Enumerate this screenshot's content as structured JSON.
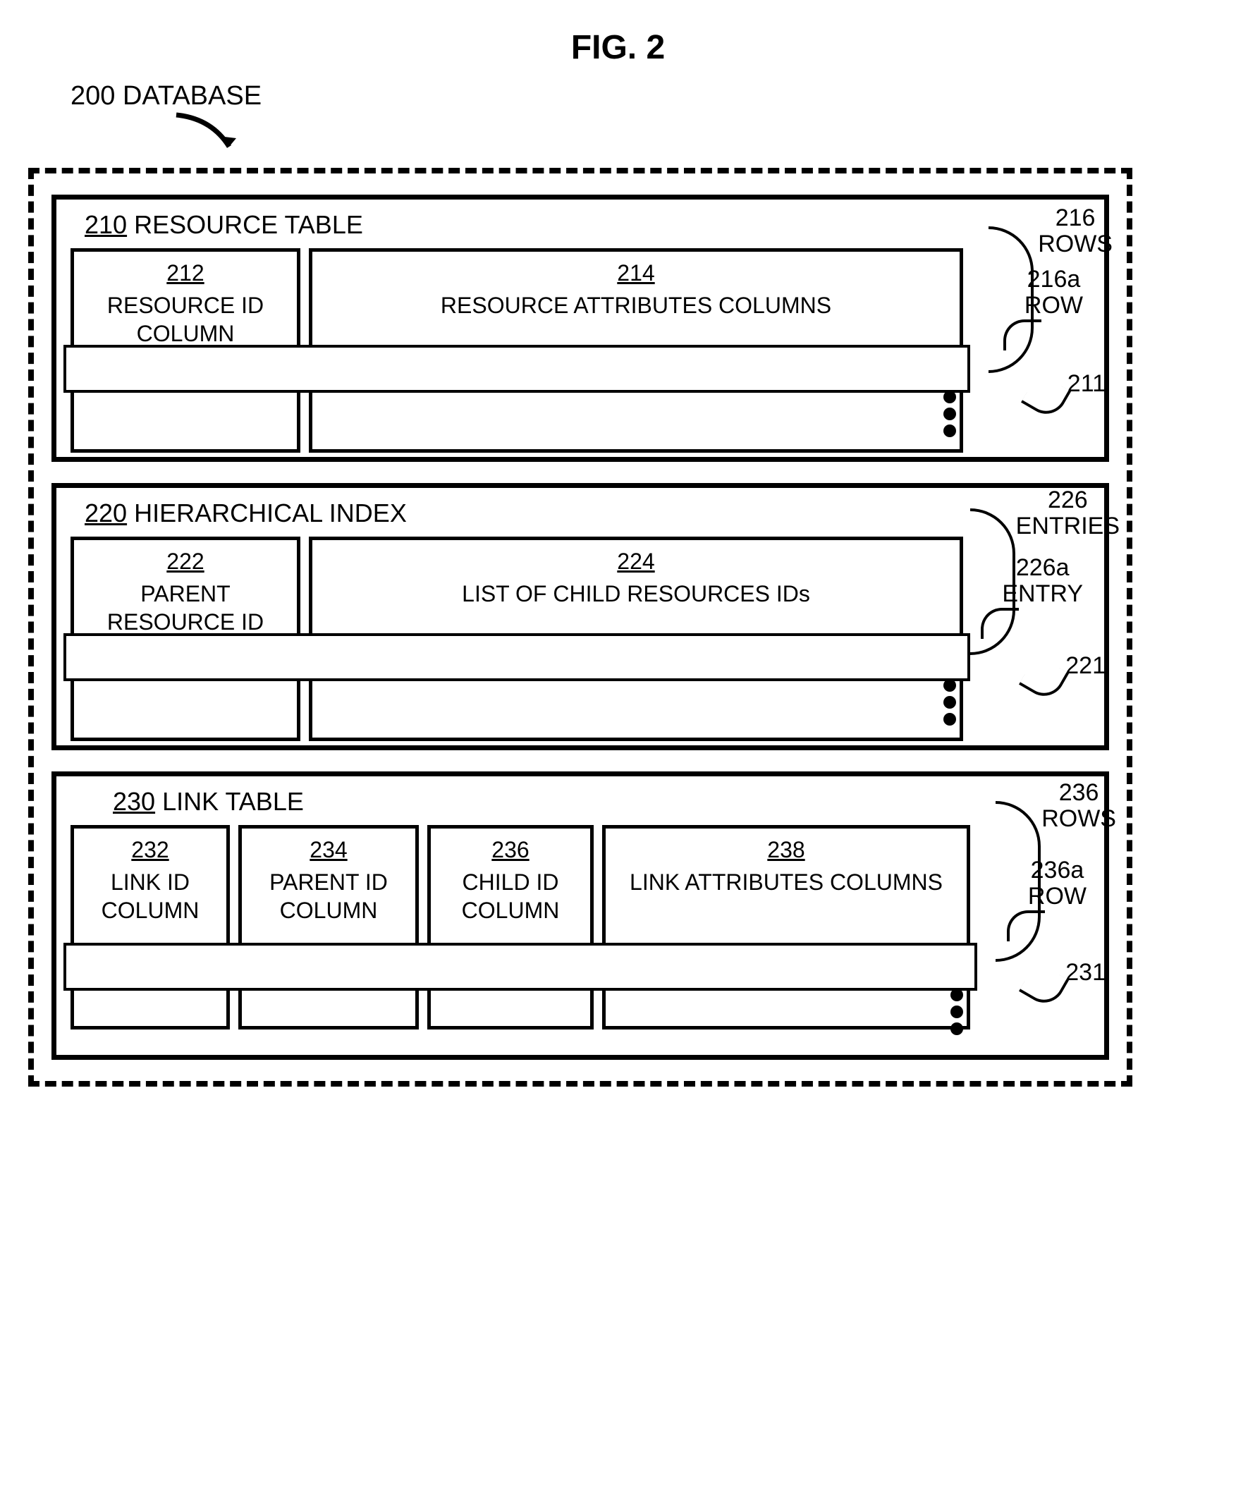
{
  "figure_title": "FIG. 2",
  "database": {
    "ref": "200",
    "label": "DATABASE"
  },
  "resource_table": {
    "ref": "210",
    "label": "RESOURCE TABLE",
    "col1": {
      "ref": "212",
      "label": "RESOURCE ID COLUMN"
    },
    "col2": {
      "ref": "214",
      "label": "RESOURCE ATTRIBUTES COLUMNS"
    },
    "rows_ref": "216",
    "rows_label": "ROWS",
    "row_ref": "216a",
    "row_label": "ROW",
    "extra_ref": "211"
  },
  "hierarchical_index": {
    "ref": "220",
    "label": "HIERARCHICAL INDEX",
    "col1": {
      "ref": "222",
      "label": "PARENT RESOURCE ID"
    },
    "col2": {
      "ref": "224",
      "label": "LIST OF CHILD RESOURCES IDs"
    },
    "entries_ref": "226",
    "entries_label": "ENTRIES",
    "entry_ref": "226a",
    "entry_label": "ENTRY",
    "extra_ref": "221"
  },
  "link_table": {
    "ref": "230",
    "label": "LINK TABLE",
    "col1": {
      "ref": "232",
      "label": "LINK ID COLUMN"
    },
    "col2": {
      "ref": "234",
      "label": "PARENT ID COLUMN"
    },
    "col3": {
      "ref": "236",
      "label": "CHILD ID COLUMN"
    },
    "col4": {
      "ref": "238",
      "label": "LINK ATTRIBUTES COLUMNS"
    },
    "rows_ref": "236",
    "rows_label": "ROWS",
    "row_ref": "236a",
    "row_label": "ROW",
    "extra_ref": "231"
  }
}
